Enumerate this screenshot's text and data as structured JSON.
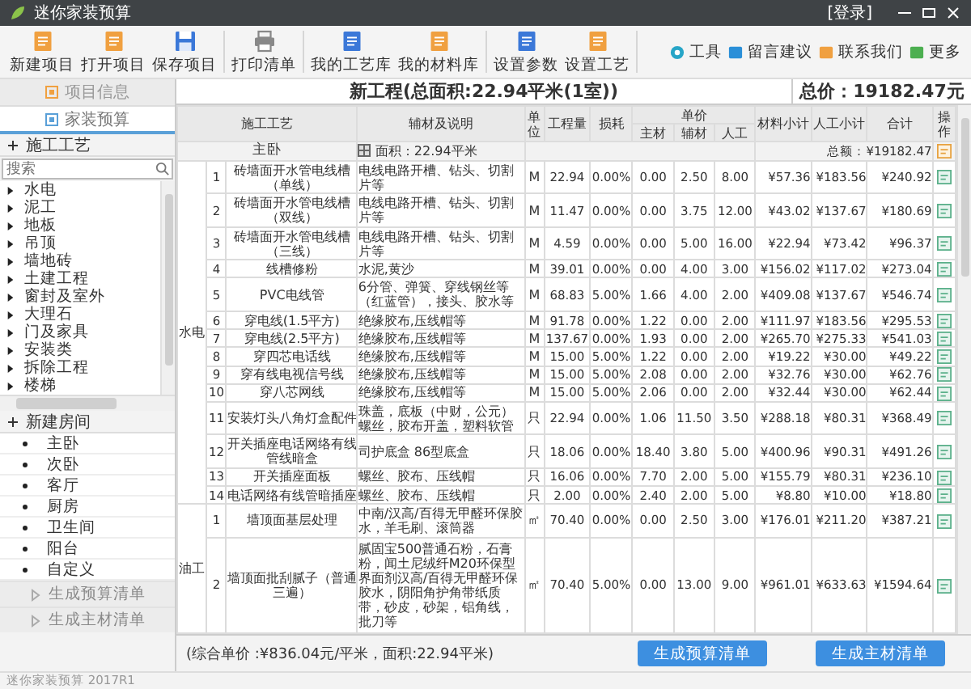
{
  "window": {
    "title": "迷你家装预算",
    "login": "[登录]"
  },
  "toolbar": [
    {
      "label": "新建项目",
      "kind": "new"
    },
    {
      "label": "打开项目",
      "kind": "open"
    },
    {
      "label": "保存项目",
      "kind": "save"
    },
    {
      "label": "打印清单",
      "kind": "print"
    },
    {
      "label": "我的工艺库",
      "kind": "craft"
    },
    {
      "label": "我的材料库",
      "kind": "material"
    },
    {
      "label": "设置参数",
      "kind": "params"
    },
    {
      "label": "设置工艺",
      "kind": "settings"
    }
  ],
  "links": [
    {
      "label": "工具",
      "kind": "tool"
    },
    {
      "label": "留言建议",
      "kind": "message"
    },
    {
      "label": "联系我们",
      "kind": "contact"
    },
    {
      "label": "更多",
      "kind": "more"
    }
  ],
  "sidebar": {
    "tabs": [
      {
        "label": "项目信息",
        "selected": false
      },
      {
        "label": "家装预算",
        "selected": true
      }
    ],
    "process": {
      "title": "施工工艺",
      "search": {
        "placeholder": "搜索"
      },
      "items": [
        {
          "label": "水电",
          "expanded": false
        },
        {
          "label": "泥工",
          "expanded": false
        },
        {
          "label": "地板",
          "expanded": false
        },
        {
          "label": "吊顶",
          "expanded": false
        },
        {
          "label": "墙地砖",
          "expanded": false
        },
        {
          "label": "土建工程",
          "expanded": false
        },
        {
          "label": "窗封及室外",
          "expanded": false
        },
        {
          "label": "大理石",
          "expanded": false
        },
        {
          "label": "门及家具",
          "expanded": false
        },
        {
          "label": "安装类",
          "expanded": false
        },
        {
          "label": "拆除工程",
          "expanded": false
        },
        {
          "label": "楼梯",
          "expanded": false
        }
      ]
    },
    "rooms": {
      "title": "新建房间",
      "items": [
        "主卧",
        "次卧",
        "客厅",
        "厨房",
        "卫生间",
        "阳台",
        "自定义"
      ]
    },
    "buttons": [
      "生成预算清单",
      "生成主材清单"
    ]
  },
  "main": {
    "title": "新工程(总面积:22.94平米(1室))",
    "total": "总价：19182.47元",
    "table": {
      "columns": [
        {
          "label": "施工工艺"
        },
        {
          "label": "辅材及说明"
        },
        {
          "label": "单位"
        },
        {
          "label": "工程量"
        },
        {
          "label": "损耗"
        },
        {
          "label": "单价",
          "children": [
            "主材",
            "辅材",
            "人工"
          ]
        },
        {
          "label": "材料小计"
        },
        {
          "label": "人工小计"
        },
        {
          "label": "合计"
        },
        {
          "label": "操作"
        }
      ],
      "room": {
        "name": "主卧",
        "area": "面积：22.94平米",
        "sum": "总额：¥19182.47"
      },
      "groups": [
        {
          "name": "水电",
          "rows": [
            [
              "1",
              "砖墙面开水管电线槽（单线）",
              "电线电路开槽、钻头、切割片等",
              "M",
              "22.94",
              "0.00%",
              "0.00",
              "2.50",
              "8.00",
              "¥57.36",
              "¥183.56",
              "¥240.92"
            ],
            [
              "2",
              "砖墙面开水管电线槽（双线）",
              "电线电路开槽、钻头、切割片等",
              "M",
              "11.47",
              "0.00%",
              "0.00",
              "3.75",
              "12.00",
              "¥43.02",
              "¥137.67",
              "¥180.69"
            ],
            [
              "3",
              "砖墙面开水管电线槽（三线）",
              "电线电路开槽、钻头、切割片等",
              "M",
              "4.59",
              "0.00%",
              "0.00",
              "5.00",
              "16.00",
              "¥22.94",
              "¥73.42",
              "¥96.37"
            ],
            [
              "4",
              "线槽修粉",
              "水泥,黄沙",
              "M",
              "39.01",
              "0.00%",
              "0.00",
              "4.00",
              "3.00",
              "¥156.02",
              "¥117.02",
              "¥273.04"
            ],
            [
              "5",
              "PVC电线管",
              "6分管、弹簧、穿线钢丝等（红蓝管），接头、胶水等",
              "M",
              "68.83",
              "5.00%",
              "1.66",
              "4.00",
              "2.00",
              "¥409.08",
              "¥137.67",
              "¥546.74"
            ],
            [
              "6",
              "穿电线(1.5平方)",
              "绝缘胶布,压线帽等",
              "M",
              "91.78",
              "0.00%",
              "1.22",
              "0.00",
              "2.00",
              "¥111.97",
              "¥183.56",
              "¥295.53"
            ],
            [
              "7",
              "穿电线(2.5平方)",
              "绝缘胶布,压线帽等",
              "M",
              "137.67",
              "0.00%",
              "1.93",
              "0.00",
              "2.00",
              "¥265.70",
              "¥275.33",
              "¥541.03"
            ],
            [
              "8",
              "穿四芯电话线",
              "绝缘胶布,压线帽等",
              "M",
              "15.00",
              "5.00%",
              "1.22",
              "0.00",
              "2.00",
              "¥19.22",
              "¥30.00",
              "¥49.22"
            ],
            [
              "9",
              "穿有线电视信号线",
              "绝缘胶布,压线帽等",
              "M",
              "15.00",
              "5.00%",
              "2.08",
              "0.00",
              "2.00",
              "¥32.76",
              "¥30.00",
              "¥62.76"
            ],
            [
              "10",
              "穿八芯网线",
              "绝缘胶布,压线帽等",
              "M",
              "15.00",
              "5.00%",
              "2.06",
              "0.00",
              "2.00",
              "¥32.44",
              "¥30.00",
              "¥62.44"
            ],
            [
              "11",
              "安装灯头八角灯盒配件",
              "珠盖，底板（中财，公元）螺丝，胶布开盖，塑料软管",
              "只",
              "22.94",
              "0.00%",
              "1.06",
              "11.50",
              "3.50",
              "¥288.18",
              "¥80.31",
              "¥368.49"
            ],
            [
              "12",
              "开关插座电话网络有线管线暗盒",
              "司护底盒 86型底盒",
              "只",
              "18.06",
              "0.00%",
              "18.40",
              "3.80",
              "5.00",
              "¥400.96",
              "¥90.31",
              "¥491.26"
            ],
            [
              "13",
              "开关插座面板",
              "螺丝、胶布、压线帽",
              "只",
              "16.06",
              "0.00%",
              "7.70",
              "2.00",
              "5.00",
              "¥155.79",
              "¥80.31",
              "¥236.10"
            ],
            [
              "14",
              "电话网络有线管暗插座",
              "螺丝、胶布、压线帽",
              "只",
              "2.00",
              "0.00%",
              "2.40",
              "2.00",
              "5.00",
              "¥8.80",
              "¥10.00",
              "¥18.80"
            ]
          ]
        },
        {
          "name": "油工",
          "rows": [
            [
              "1",
              "墙顶面基层处理",
              "中南/汉高/百得无甲醛环保胶水，羊毛刷、滚筒器",
              "㎡",
              "70.40",
              "0.00%",
              "0.00",
              "2.50",
              "3.00",
              "¥176.01",
              "¥211.20",
              "¥387.21"
            ],
            [
              "2",
              "墙顶面批刮腻子（普通三遍）",
              "腻固宝500普通石粉，石膏粉，闻土尼绒纤M20环保型界面剂汉高/百得无甲醛环保胶水，阴阳角护角带纸质带，砂皮，砂架，铝角线，批刀等",
              "㎡",
              "70.40",
              "5.00%",
              "0.00",
              "13.00",
              "9.00",
              "¥961.01",
              "¥633.63",
              "¥1594.64"
            ]
          ]
        }
      ]
    },
    "summary": "(综合单价 :¥836.04元/平米，面积:22.94平米)",
    "buttons": [
      "生成预算清单",
      "生成主材清单"
    ]
  },
  "status_bar": "迷你家装预算 2017R1"
}
